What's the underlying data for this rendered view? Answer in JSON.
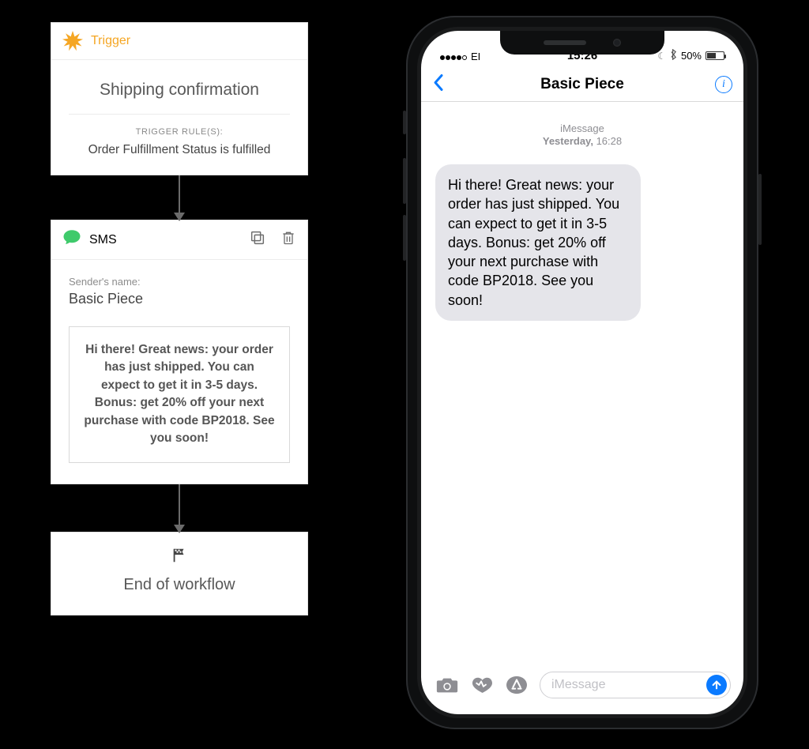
{
  "workflow": {
    "trigger": {
      "header_label": "Trigger",
      "title": "Shipping confirmation",
      "rules_label": "TRIGGER RULE(S):",
      "rule": "Order Fulfillment Status is fulfilled"
    },
    "sms": {
      "header_label": "SMS",
      "sender_label": "Sender's name:",
      "sender_name": "Basic Piece",
      "message": "Hi there! Great news: your order has just shipped. You can expect to get it in 3-5 days. Bonus: get 20% off your next purchase with code BP2018. See you soon!"
    },
    "end": {
      "label": "End of workflow"
    }
  },
  "phone": {
    "status": {
      "carrier": "EI",
      "time": "15:26",
      "battery_pct": "50%"
    },
    "nav": {
      "title": "Basic Piece"
    },
    "chat": {
      "meta_line1": "iMessage",
      "meta_day": "Yesterday,",
      "meta_time": "16:28",
      "bubble": "Hi there! Great news: your order has just shipped. You can expect to get it in 3-5 days. Bonus: get 20% off your next purchase with code BP2018. See you soon!",
      "input_placeholder": "iMessage"
    }
  }
}
